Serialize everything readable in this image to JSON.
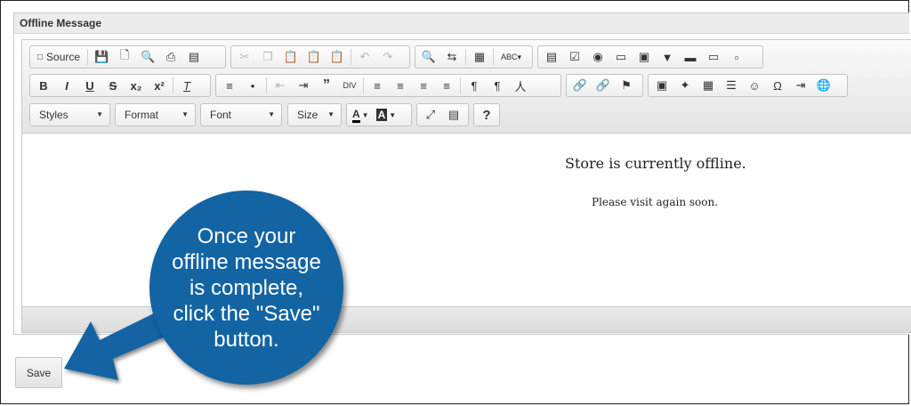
{
  "panel": {
    "title": "Offline Message"
  },
  "toolbar": {
    "source_label": "Source",
    "styles_label": "Styles",
    "format_label": "Format",
    "font_label": "Font",
    "size_label": "Size",
    "row1_icons": [
      "save-icon",
      "new-page-icon",
      "preview-icon",
      "print-icon",
      "templates-icon",
      "cut-icon",
      "copy-icon",
      "paste-icon",
      "paste-text-icon",
      "paste-word-icon",
      "undo-icon",
      "redo-icon",
      "find-icon",
      "replace-icon",
      "select-all-icon",
      "spellcheck-icon",
      "form-icon",
      "checkbox-icon",
      "radio-icon",
      "textfield-icon",
      "textarea-icon",
      "select-icon",
      "button-icon",
      "image-button-icon",
      "hidden-field-icon"
    ],
    "row2_icons": [
      "bold-icon",
      "italic-icon",
      "underline-icon",
      "strikethrough-icon",
      "subscript-icon",
      "superscript-icon",
      "remove-format-icon",
      "numbered-list-icon",
      "bulleted-list-icon",
      "outdent-icon",
      "indent-icon",
      "blockquote-icon",
      "div-icon",
      "align-left-icon",
      "align-center-icon",
      "align-right-icon",
      "justify-icon",
      "ltr-icon",
      "rtl-icon",
      "language-icon",
      "link-icon",
      "unlink-icon",
      "anchor-icon",
      "image-icon",
      "flash-icon",
      "table-icon",
      "horizontal-line-icon",
      "smiley-icon",
      "special-char-icon",
      "page-break-icon",
      "iframe-icon"
    ]
  },
  "content": {
    "heading": "Store is currently offline.",
    "body": "Please visit again soon."
  },
  "save_button_label": "Save",
  "callout": {
    "text": "Once your offline message is complete, click the \"Save\" button.",
    "color": "#1264a3"
  }
}
